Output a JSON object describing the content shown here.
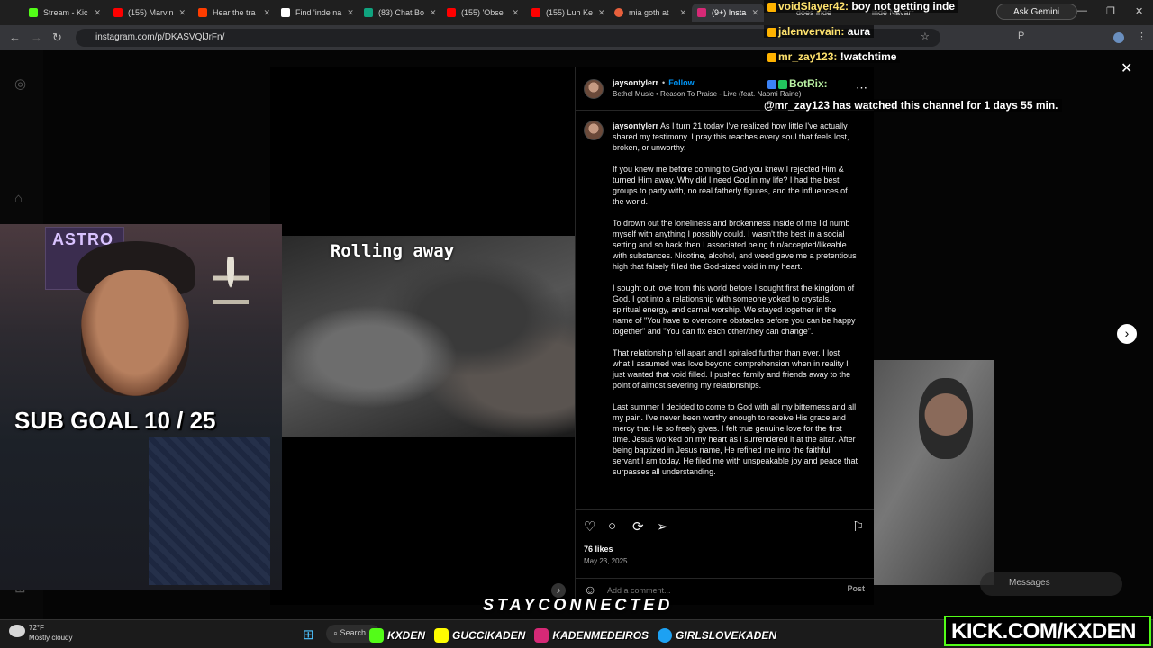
{
  "browser": {
    "tabs": [
      {
        "label": "Stream - Kic",
        "color": "#53fc18"
      },
      {
        "label": "(155) Marvin",
        "color": "#ff0000"
      },
      {
        "label": "Hear the tra",
        "color": "#ff3d00"
      },
      {
        "label": "Find 'inde na",
        "color": "#ffffff"
      },
      {
        "label": "(83) Chat Bo",
        "color": "#10a37f"
      },
      {
        "label": "(155) 'Obse",
        "color": "#ff0000"
      },
      {
        "label": "(155) Luh Ke",
        "color": "#ff0000"
      },
      {
        "label": "mia goth at",
        "color": "#e8603c"
      },
      {
        "label": "(9+) Insta",
        "color": "#d62976"
      },
      {
        "label": "does inde",
        "color": "#4285f4"
      },
      {
        "label": "inde Navarr",
        "color": "#4285f4"
      }
    ],
    "url": "instagram.com/p/DKASVQlJrFn/",
    "ask_gemini": "Ask Gemini"
  },
  "post": {
    "username": "jaysontylerr",
    "follow": "Follow",
    "song": "Bethel Music • Reason To Praise - Live (feat. Naomi Raine)",
    "media_caption": "Rolling away",
    "caption_user": "jaysontylerr",
    "caption_paragraphs": [
      "As I turn 21 today I've realized how little I've actually shared my testimony. I pray this reaches every soul that feels lost, broken, or unworthy.",
      "If you knew me before coming to God you knew I rejected Him & turned Him away. Why did I need God in my life? I had the best groups to party with, no real fatherly figures, and the influences of the world.",
      "To drown out the loneliness and brokenness inside of me I'd numb myself with anything I possibly could. I wasn't the best in a social setting and so back then I associated being fun/accepted/likeable with substances. Nicotine, alcohol, and weed gave me a pretentious high that falsely filled the God-sized void in my heart.",
      "I sought out love from this world before I sought first the kingdom of God. I got into a relationship with someone yoked to crystals, spiritual energy, and carnal worship. We stayed together in the name of \"You have to overcome obstacles before you can be happy together\" and \"You can fix each other/they can change\".",
      "That relationship fell apart and I spiraled further than ever. I lost what I assumed was love beyond comprehension when in reality I just wanted that void filled. I pushed family and friends away to the point of almost severing my relationships.",
      "Last summer I decided to come to God with all my bitterness and all my pain. I've never been worthy enough to receive His grace and mercy that He so freely gives. I felt true genuine love for the first time. Jesus worked on my heart as i surrendered it at the altar. After being baptized in Jesus name, He refined me into the faithful servant I am today. He filed me with unspeakable joy and peace that surpasses all understanding."
    ],
    "likes": "76 likes",
    "date": "May 23, 2025",
    "comment_placeholder": "Add a comment...",
    "post_button": "Post",
    "messages": "Messages"
  },
  "stream": {
    "poster_text": "ASTRO",
    "sub_goal": "SUB GOAL 10 / 25",
    "stay_connected": "STAYCONNECTED",
    "socials": [
      {
        "label": "KXDEN",
        "color": "#53fc18"
      },
      {
        "label": "GUCCIKADEN",
        "color": "#fffc00"
      },
      {
        "label": "KADENMEDEIROS",
        "color": "#d62976"
      },
      {
        "label": "GIRLSLOVEKADEN",
        "color": "#1da1f2"
      }
    ],
    "kick_url": "KICK.COM/KXDEN"
  },
  "chat": [
    {
      "name": "voidSlayer42:",
      "text": "boy not getting inde"
    },
    {
      "name": "jalenvervain:",
      "text": "aura"
    },
    {
      "name": "mr_zay123:",
      "text": "!watchtime"
    },
    {
      "name": "BotRix:",
      "text": ""
    },
    {
      "name": "",
      "text": "@mr_zay123 has watched this channel for 1 days 55 min."
    }
  ],
  "taskbar": {
    "temp": "72°F",
    "condition": "Mostly cloudy",
    "search": "Search"
  }
}
